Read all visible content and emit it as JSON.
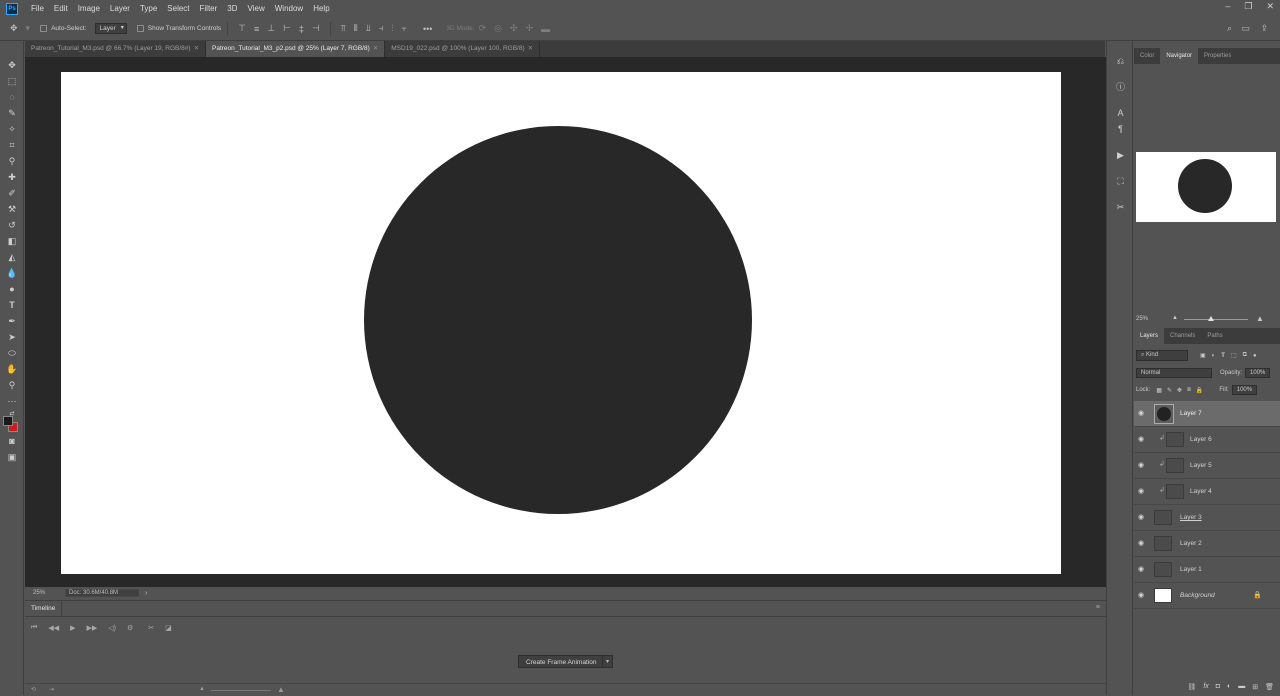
{
  "app": {
    "menu": [
      "File",
      "Edit",
      "Image",
      "Layer",
      "Type",
      "Select",
      "Filter",
      "3D",
      "View",
      "Window",
      "Help"
    ],
    "logo_text": "Ps"
  },
  "options_bar": {
    "auto_select_label": "Auto-Select:",
    "auto_select_value": "Layer",
    "transform_label": "Show Transform Controls",
    "mode_3d_label": "3D Mode:"
  },
  "document_tabs": [
    {
      "label": "Patreon_Tutorial_M3.psd @ 66.7% (Layer 19, RGB/8#)",
      "active": false
    },
    {
      "label": "Patreon_Tutorial_M3_p2.psd @ 25% (Layer 7, RGB/8)",
      "active": true
    },
    {
      "label": "MSD19_022.psd @ 100% (Layer 100, RGB/8)",
      "active": false
    }
  ],
  "status": {
    "zoom": "25%",
    "doc_info": "Doc: 30.6M/40.8M"
  },
  "timeline": {
    "tab_label": "Timeline",
    "create_button": "Create Frame Animation"
  },
  "panels": {
    "top_tabs": [
      "Color",
      "Navigator",
      "Properties"
    ],
    "top_active": "Navigator",
    "navigator_zoom": "25%",
    "layer_tabs": [
      "Layers",
      "Channels",
      "Paths"
    ],
    "layer_active": "Layers",
    "filter_kind": "Kind",
    "blend_mode": "Normal",
    "opacity_label": "Opacity:",
    "opacity_value": "100%",
    "lock_label": "Lock:",
    "fill_label": "Fill:",
    "fill_value": "100%"
  },
  "layers": [
    {
      "name": "Layer 7",
      "selected": true,
      "clipped": false
    },
    {
      "name": "Layer 6",
      "selected": false,
      "clipped": true
    },
    {
      "name": "Layer 5",
      "selected": false,
      "clipped": true
    },
    {
      "name": "Layer 4",
      "selected": false,
      "clipped": true
    },
    {
      "name": "Layer 3",
      "selected": false,
      "clipped": false
    },
    {
      "name": "Layer 2",
      "selected": false,
      "clipped": false
    },
    {
      "name": "Layer 1",
      "selected": false,
      "clipped": false
    },
    {
      "name": "Background",
      "selected": false,
      "clipped": false
    }
  ],
  "colors": {
    "foreground": "#1a1a1a",
    "background": "#d01c1c",
    "circle": "#282828"
  }
}
